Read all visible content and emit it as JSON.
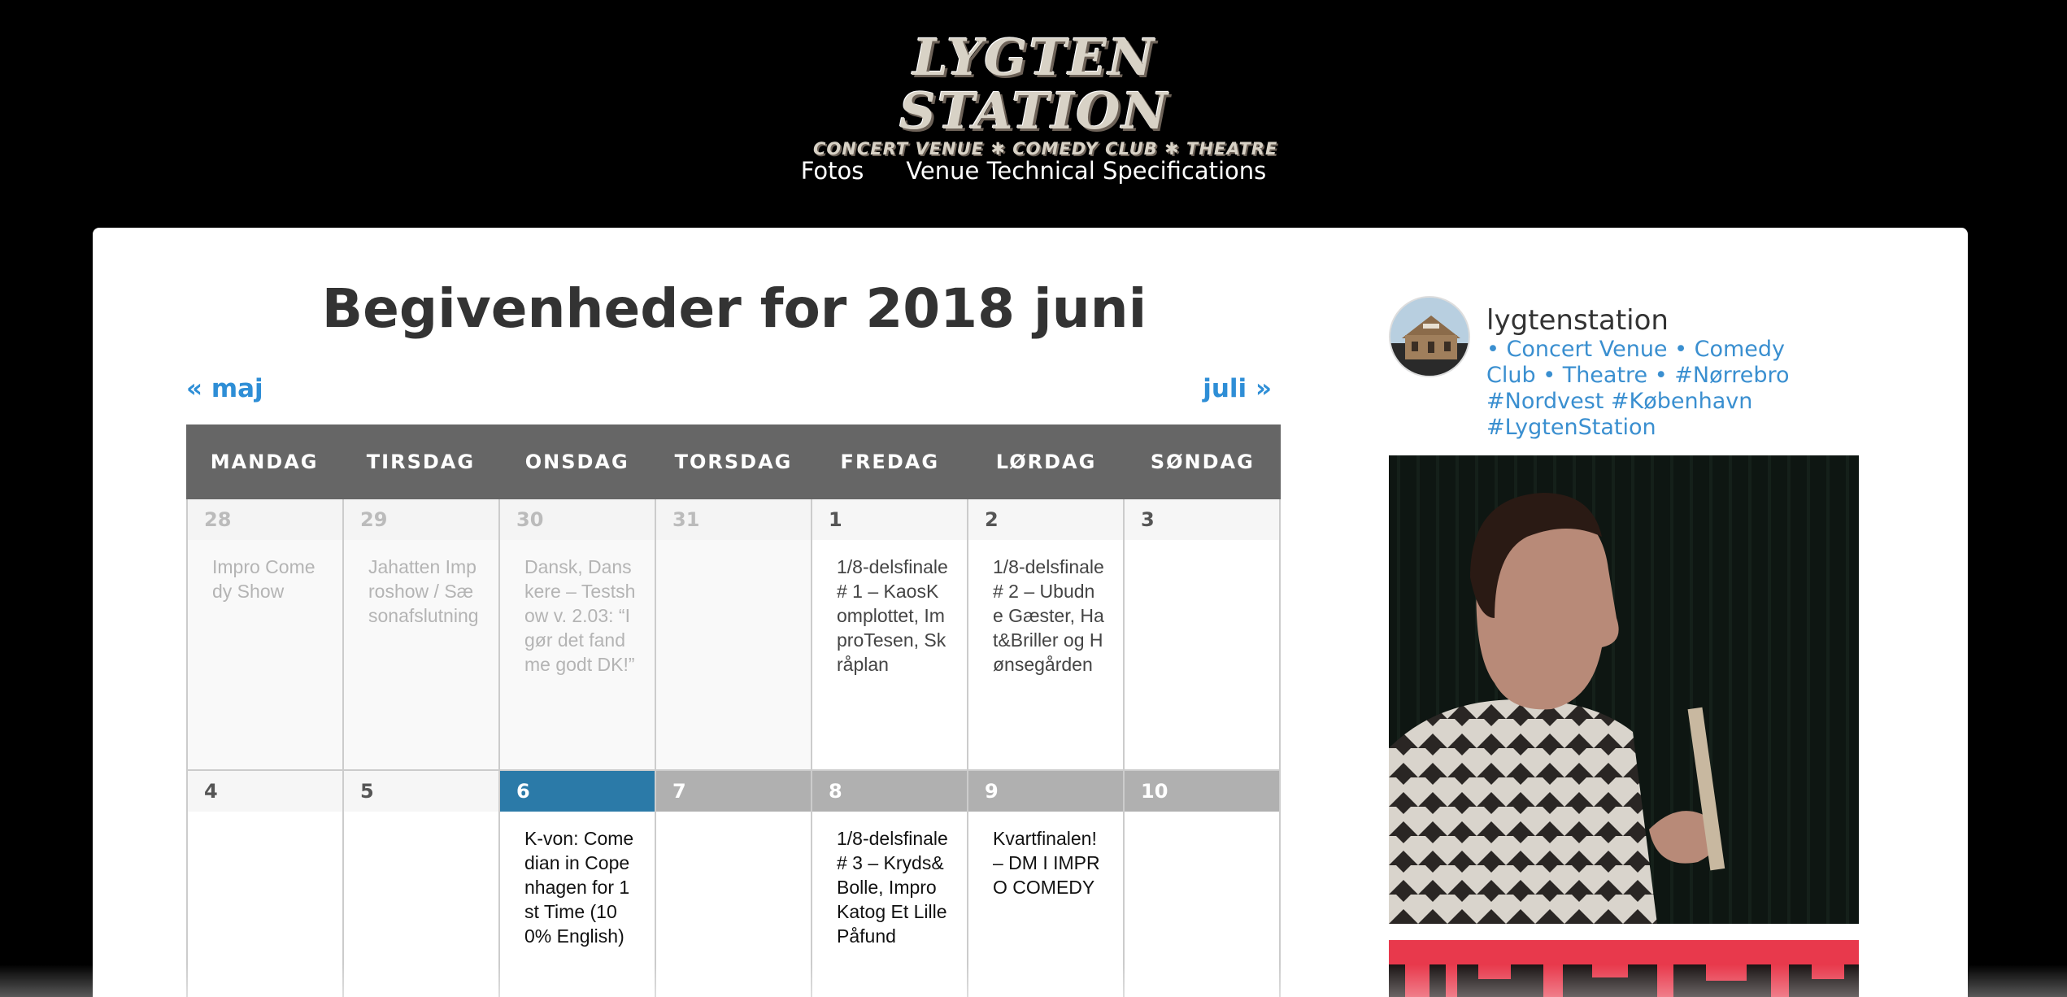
{
  "header": {
    "logo_main": "LYGTEN STATION",
    "logo_sub": "CONCERT VENUE ✱ COMEDY CLUB ✱ THEATRE",
    "nav": [
      "Fotos",
      "Venue Technical Specifications"
    ]
  },
  "calendar": {
    "title": "Begivenheder for 2018 juni",
    "prev_label": "« maj",
    "next_label": "juli »",
    "weekdays": [
      "MANDAG",
      "TIRSDAG",
      "ONSDAG",
      "TORSDAG",
      "FREDAG",
      "LØRDAG",
      "SØNDAG"
    ],
    "weeks": [
      [
        {
          "num": "28",
          "event": "Impro Comedy Show"
        },
        {
          "num": "29",
          "event": "Jahatten Improshow / Sæsonafslutning"
        },
        {
          "num": "30",
          "event": "Dansk, Danskere – Testshow v. 2.03: “I gør det fandme godt DK!”"
        },
        {
          "num": "31",
          "event": ""
        },
        {
          "num": "1",
          "event": "1/8-delsfinale # 1 – KaosKomplottet, ImproTesen, Skråplan"
        },
        {
          "num": "2",
          "event": "1/8-delsfinale # 2 – Ubudne Gæster, Hat&Briller og Hønsegården"
        },
        {
          "num": "3",
          "event": ""
        }
      ],
      [
        {
          "num": "4",
          "event": ""
        },
        {
          "num": "5",
          "event": ""
        },
        {
          "num": "6",
          "event": "K-von: Comedian in Copenhagen for 1st Time (100% English)"
        },
        {
          "num": "7",
          "event": ""
        },
        {
          "num": "8",
          "event": "1/8-delsfinale # 3 – Kryds&Bolle, ImproKatog Et Lille Påfund"
        },
        {
          "num": "9",
          "event": "Kvartfinalen! – DM I IMPRO COMEDY"
        },
        {
          "num": "10",
          "event": ""
        }
      ]
    ]
  },
  "sidebar": {
    "username": "lygtenstation",
    "bio": "• Concert Venue • Comedy Club • Theatre • #Nørrebro #Nordvest #København #LygtenStation"
  },
  "colors": {
    "accent": "#2e8ed6",
    "today": "#2b7aa8",
    "header_bg": "#666666",
    "past": "#b0b0b0"
  }
}
